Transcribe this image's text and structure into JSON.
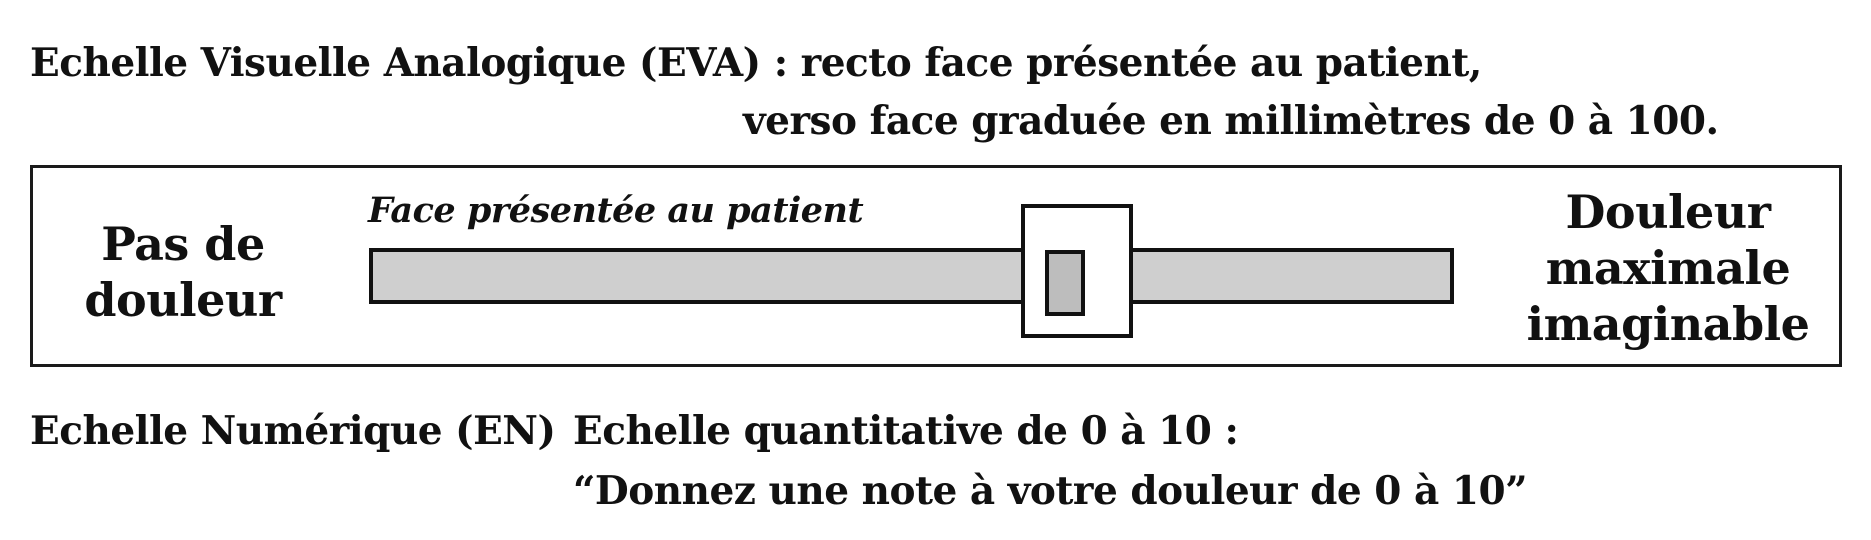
{
  "eva": {
    "title": "Echelle Visuelle Analogique (EVA) : recto face présentée au patient,",
    "line2": "verso face graduée en millimètres de 0 à 100.",
    "scale": {
      "caption": "Face présentée au patient",
      "left_anchor": [
        "Pas de",
        "douleur"
      ],
      "right_anchor": [
        "Douleur",
        "maximale",
        "imaginable"
      ],
      "track_color": "#cfcfcf",
      "cursor_color": "#bdbdbd"
    }
  },
  "en": {
    "title": "Echelle Numérique (EN)",
    "line1": "Echelle quantitative de 0 à 10 :",
    "line2": "“Donnez une note à votre douleur de 0 à 10”"
  }
}
